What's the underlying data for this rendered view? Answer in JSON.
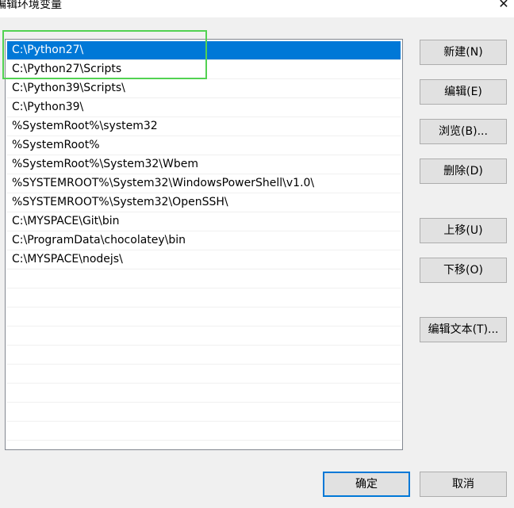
{
  "window": {
    "title": "编辑环境变量",
    "close": "✕"
  },
  "paths": [
    "C:\\Python27\\",
    "C:\\Python27\\Scripts",
    "C:\\Python39\\Scripts\\",
    "C:\\Python39\\",
    "%SystemRoot%\\system32",
    "%SystemRoot%",
    "%SystemRoot%\\System32\\Wbem",
    "%SYSTEMROOT%\\System32\\WindowsPowerShell\\v1.0\\",
    "%SYSTEMROOT%\\System32\\OpenSSH\\",
    "C:\\MYSPACE\\Git\\bin",
    "C:\\ProgramData\\chocolatey\\bin",
    "C:\\MYSPACE\\nodejs\\"
  ],
  "buttons": {
    "new": "新建(N)",
    "edit": "编辑(E)",
    "browse": "浏览(B)...",
    "delete": "删除(D)",
    "move_up": "上移(U)",
    "move_down": "下移(O)",
    "edit_text": "编辑文本(T)...",
    "ok": "确定",
    "cancel": "取消"
  },
  "colors": {
    "selection": "#0078d7",
    "annotation_box": "#52d252"
  }
}
